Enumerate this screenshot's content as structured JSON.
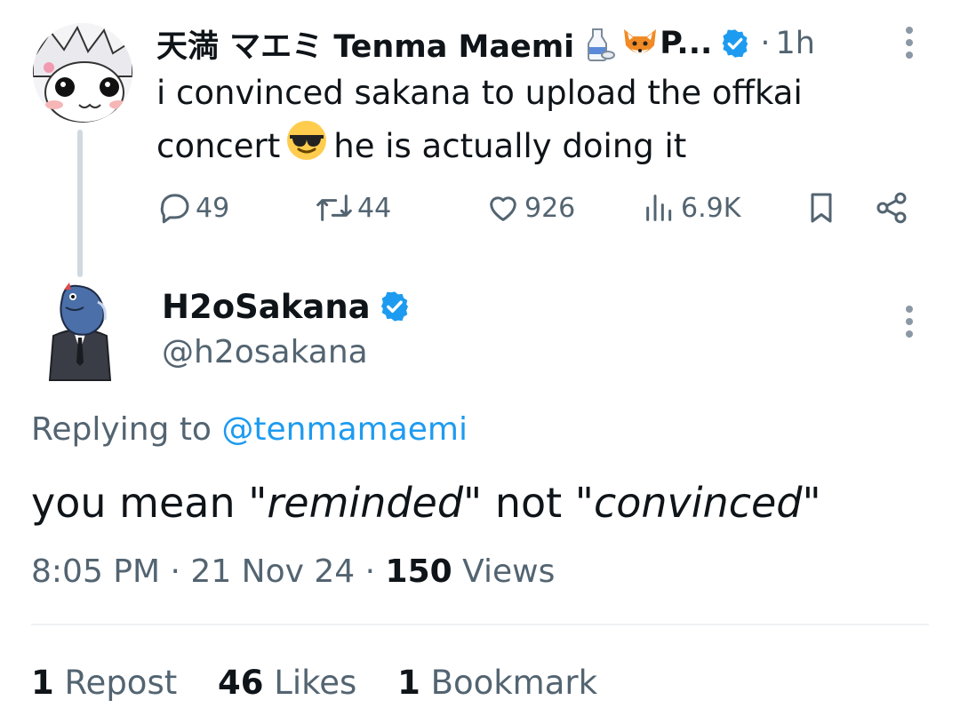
{
  "parent_tweet": {
    "display_name": "天満 マエミ Tenma Maemi",
    "name_suffix": "P...",
    "separator": "·",
    "time": "1h",
    "text_part1": "i convinced sakana to upload the offkai concert",
    "text_part2": "he is actually doing it",
    "emoji_in_text": "sunglasses-face",
    "name_emojis": [
      "sake-bottle",
      "fox-face"
    ],
    "actions": {
      "replies": "49",
      "reposts": "44",
      "likes": "926",
      "views": "6.9K"
    }
  },
  "reply_tweet": {
    "display_name": "H2oSakana",
    "handle": "@h2osakana",
    "replying_prefix": "Replying to",
    "replying_handle": "@tenmamaemi",
    "text": {
      "t1": "you mean \"",
      "em1": "reminded",
      "t2": "\" not \"",
      "em2": "convinced",
      "t3": "\""
    },
    "time": "8:05 PM",
    "date": "21 Nov 24",
    "sep": "·",
    "views_count": "150",
    "views_label": "Views",
    "reposts_count": "1",
    "reposts_label": "Repost",
    "likes_count": "46",
    "likes_label": "Likes",
    "bookmarks_count": "1",
    "bookmarks_label": "Bookmark"
  },
  "colors": {
    "accent": "#1d9bf0",
    "secondary_text": "#536471",
    "primary_text": "#0f1419",
    "divider": "#eff3f4"
  }
}
